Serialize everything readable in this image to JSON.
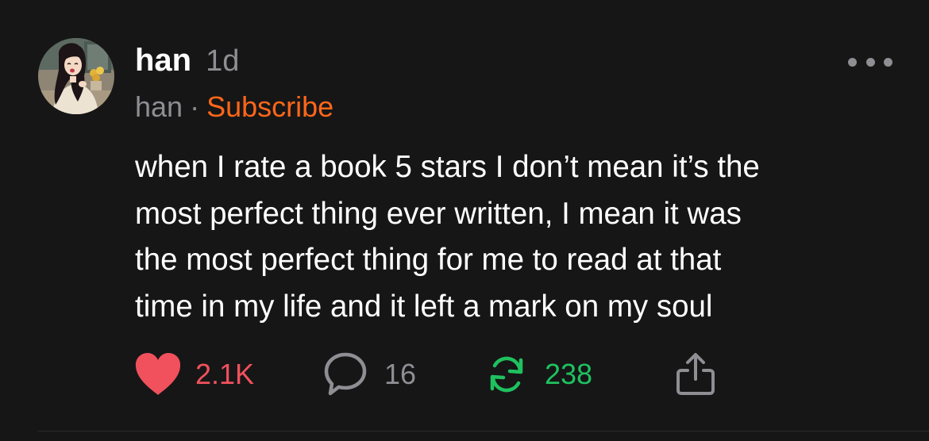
{
  "post": {
    "author_name": "han",
    "timestamp": "1d",
    "handle": "han",
    "separator": "·",
    "subscribe_label": "Subscribe",
    "body_lines": [
      "when I rate a book 5 stars I don’t mean it’s the",
      "most perfect thing ever written, I mean it was",
      "the most perfect thing for me to read at that",
      "time in my life and it left a mark on my soul"
    ]
  },
  "actions": {
    "likes": "2.1K",
    "comments": "16",
    "restacks": "238",
    "like_icon": "heart-icon",
    "comment_icon": "comment-bubble-icon",
    "restack_icon": "restack-arrows-icon",
    "share_icon": "share-icon"
  },
  "colors": {
    "background": "#161617",
    "text": "#ffffff",
    "muted": "#8e8e93",
    "subscribe": "#ff6719",
    "like": "#f0515c",
    "restack": "#1fc15f"
  }
}
